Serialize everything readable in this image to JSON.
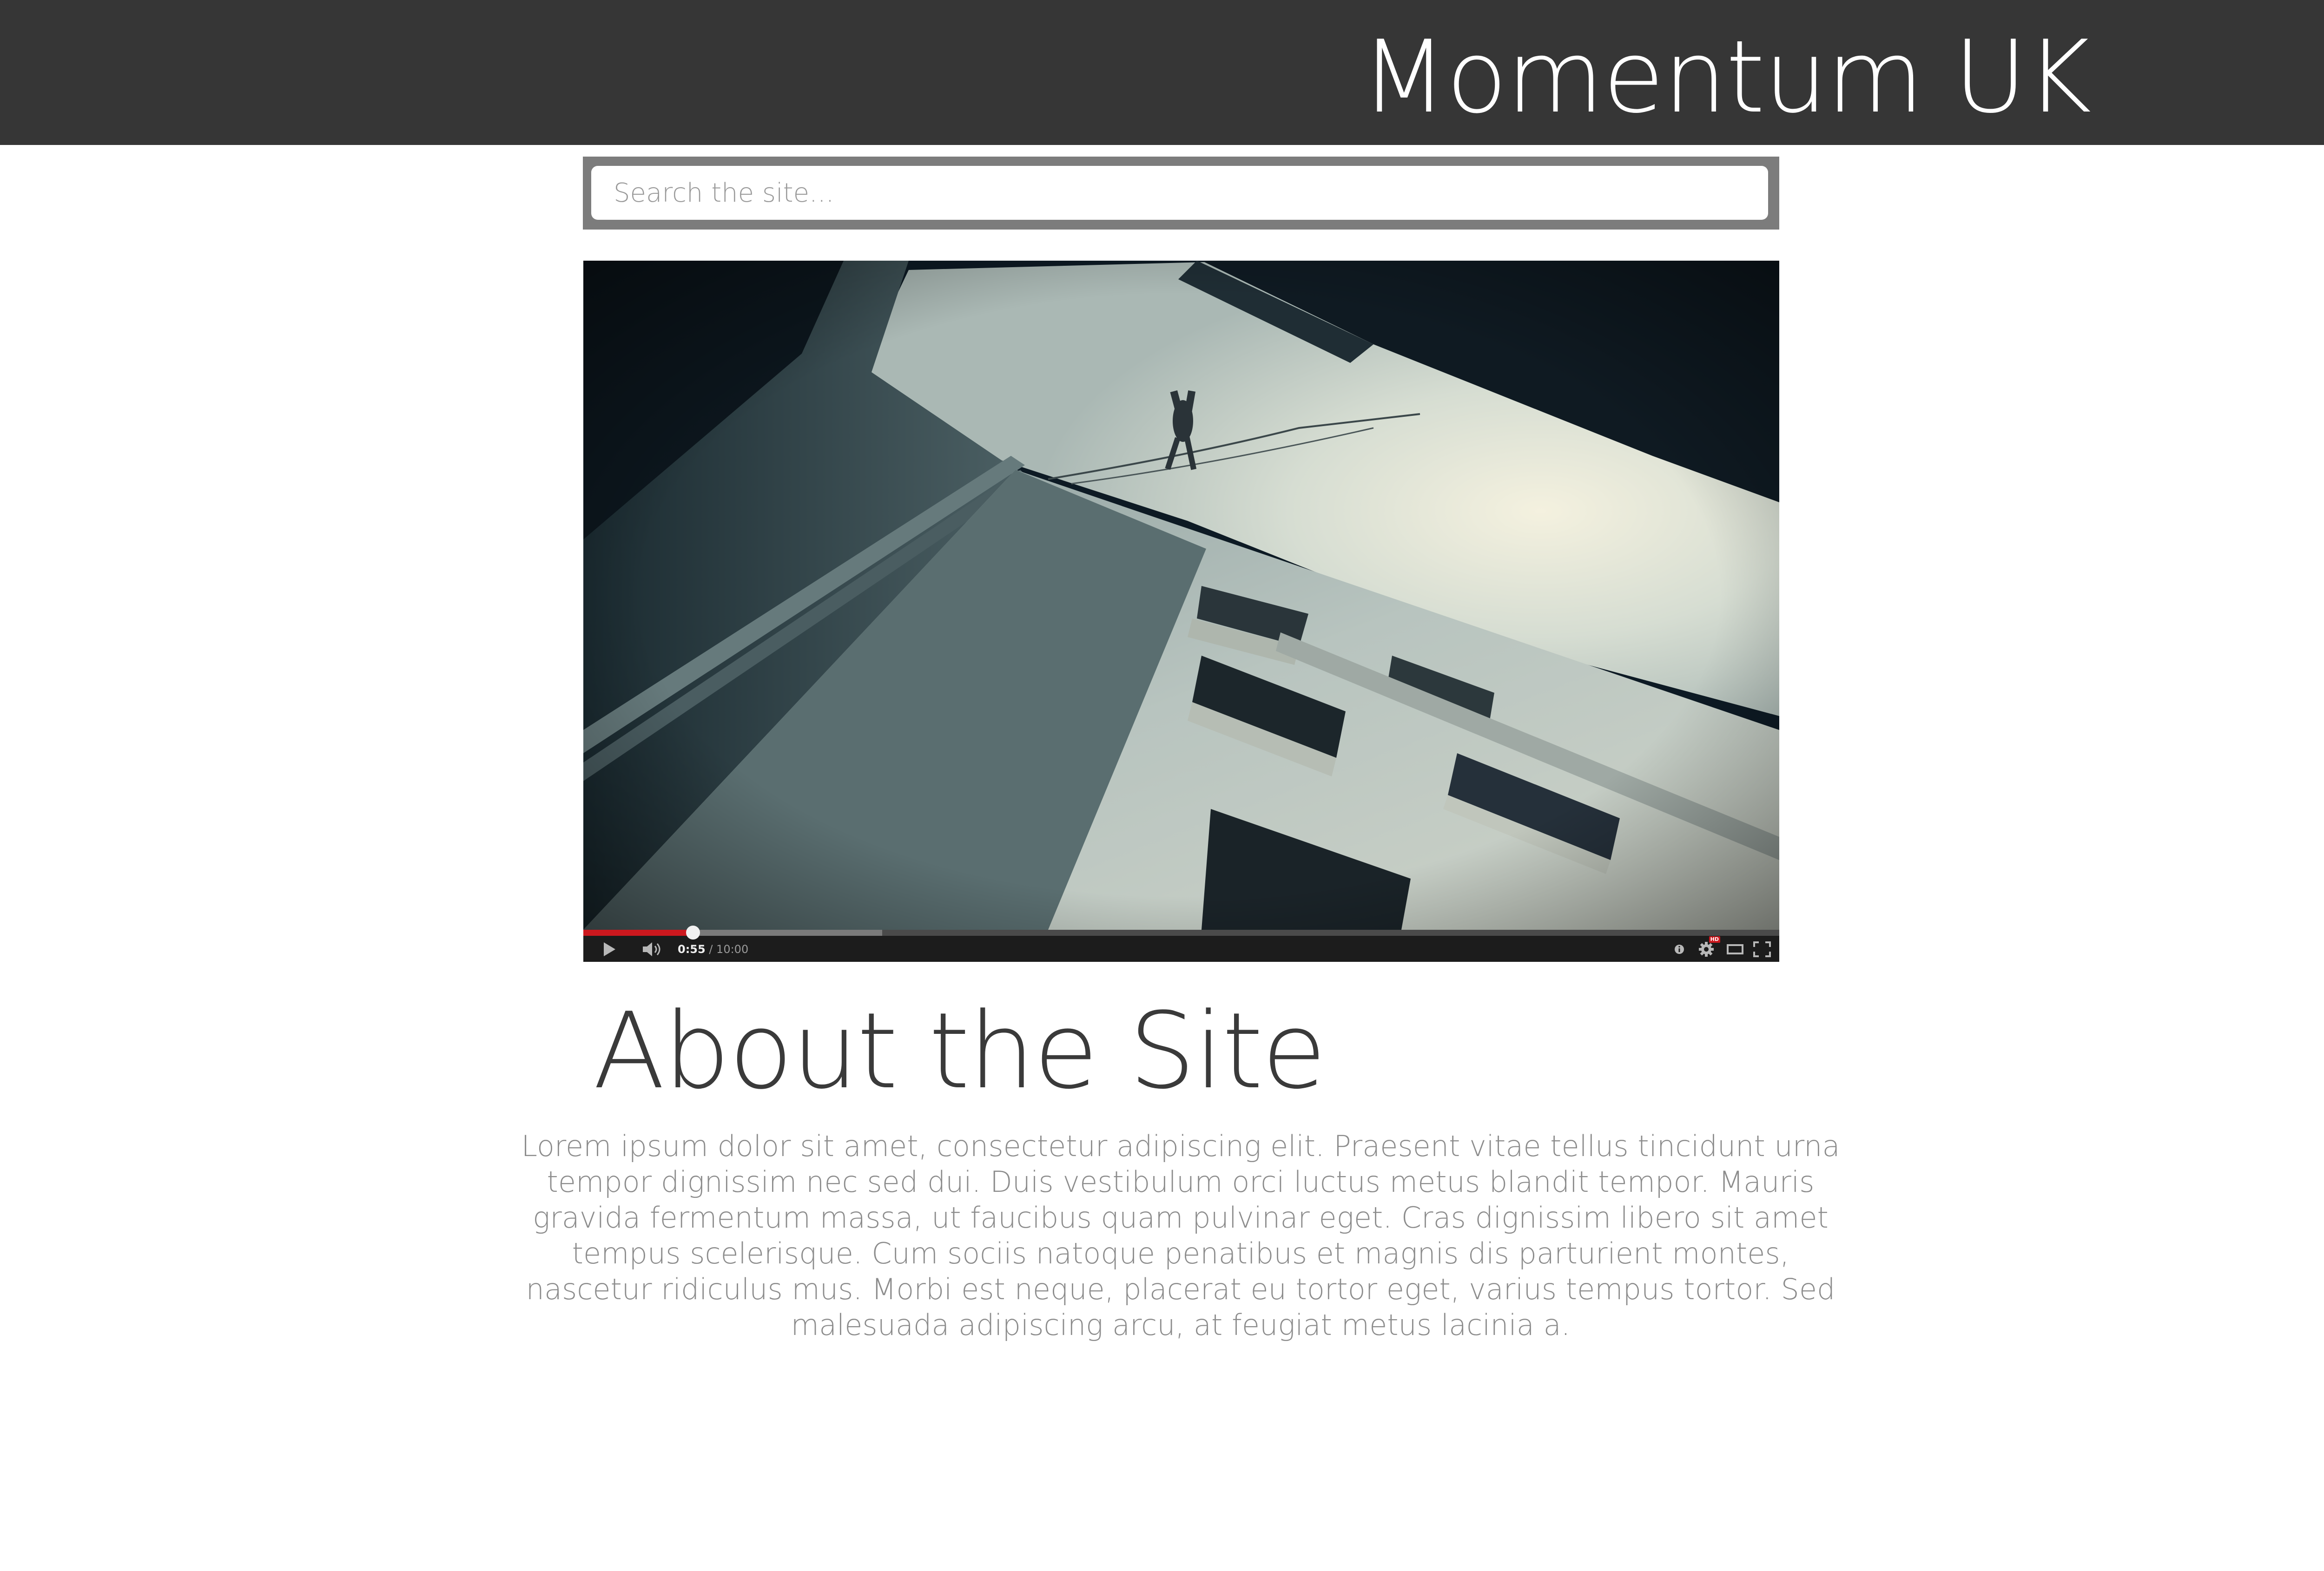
{
  "header": {
    "site_title": "Momentum UK"
  },
  "search": {
    "placeholder": "Search the site..."
  },
  "video": {
    "current_time": "0:55",
    "separator": " / ",
    "duration": "10:00",
    "played_fraction": 0.0917,
    "buffered_fraction": 0.25,
    "hd_badge": "HD",
    "progress_color": "#cc181e",
    "icons": [
      "play-icon",
      "volume-icon",
      "info-icon",
      "settings-icon",
      "theater-mode-icon",
      "fullscreen-icon"
    ]
  },
  "about": {
    "heading": "About the Site",
    "body": "Lorem ipsum dolor sit amet, consectetur adipiscing elit. Praesent vitae tellus tincidunt urna tempor dignissim nec sed dui. Duis vestibulum orci luctus metus blandit tempor. Mauris gravida fermentum massa, ut faucibus quam pulvinar eget. Cras dignissim libero sit amet tempus scelerisque. Cum sociis natoque penatibus et magnis dis parturient montes, nascetur ridiculus mus. Morbi est neque, placerat eu tortor eget, varius tempus tortor. Sed malesuada adipiscing arcu, at feugiat metus lacinia a."
  },
  "colors": {
    "header_bg": "#363636",
    "search_frame": "#7c7c7c",
    "heading_text": "#3a3a3a",
    "body_text": "#8c8c8c"
  }
}
